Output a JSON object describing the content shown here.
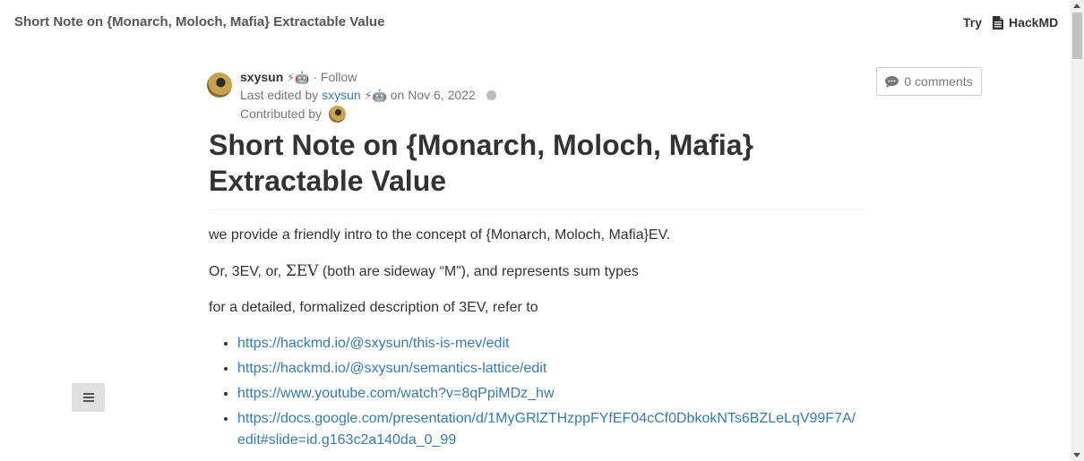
{
  "topbar": {
    "title": "Short Note on {Monarch, Moloch, Mafia} Extractable Value",
    "try_label": "Try",
    "brand_label": "HackMD",
    "brand_icon": "file-text-icon"
  },
  "meta": {
    "author": "sxysun",
    "author_emoji": "⚡🤖",
    "separator": "·",
    "follow_label": "Follow",
    "last_edited_prefix": "Last edited by",
    "editor": "sxysun",
    "editor_emoji": "⚡🤖",
    "edited_on": "on Nov 6, 2022",
    "contributed_label": "Contributed by"
  },
  "comments": {
    "label": "0 comments",
    "icon": "comment-icon"
  },
  "article": {
    "heading": "Short Note on {Monarch, Moloch, Mafia} Extractable Value",
    "p1": "we provide a friendly intro to the concept of {Monarch, Moloch, Mafia}EV.",
    "p2_before": "Or, 3EV, or,",
    "p2_sev": "ΣEV",
    "p2_after": "(both are sideway “M”), and represents sum types",
    "p3": "for a detailed, formalized description of 3EV, refer to",
    "links": [
      "https://hackmd.io/@sxysun/this-is-mev/edit",
      "https://hackmd.io/@sxysun/semantics-lattice/edit",
      "https://www.youtube.com/watch?v=8qPpiMDz_hw",
      "https://docs.google.com/presentation/d/1MyGRlZTHzppFYfEF04cCf0DbkokNTs6BZLeLqV99F7A/edit#slide=id.g163c2a140da_0_99"
    ]
  },
  "toc": {
    "icon": "menu-icon"
  },
  "colors": {
    "link": "#337ab7",
    "text": "#333333",
    "muted": "#777777"
  }
}
